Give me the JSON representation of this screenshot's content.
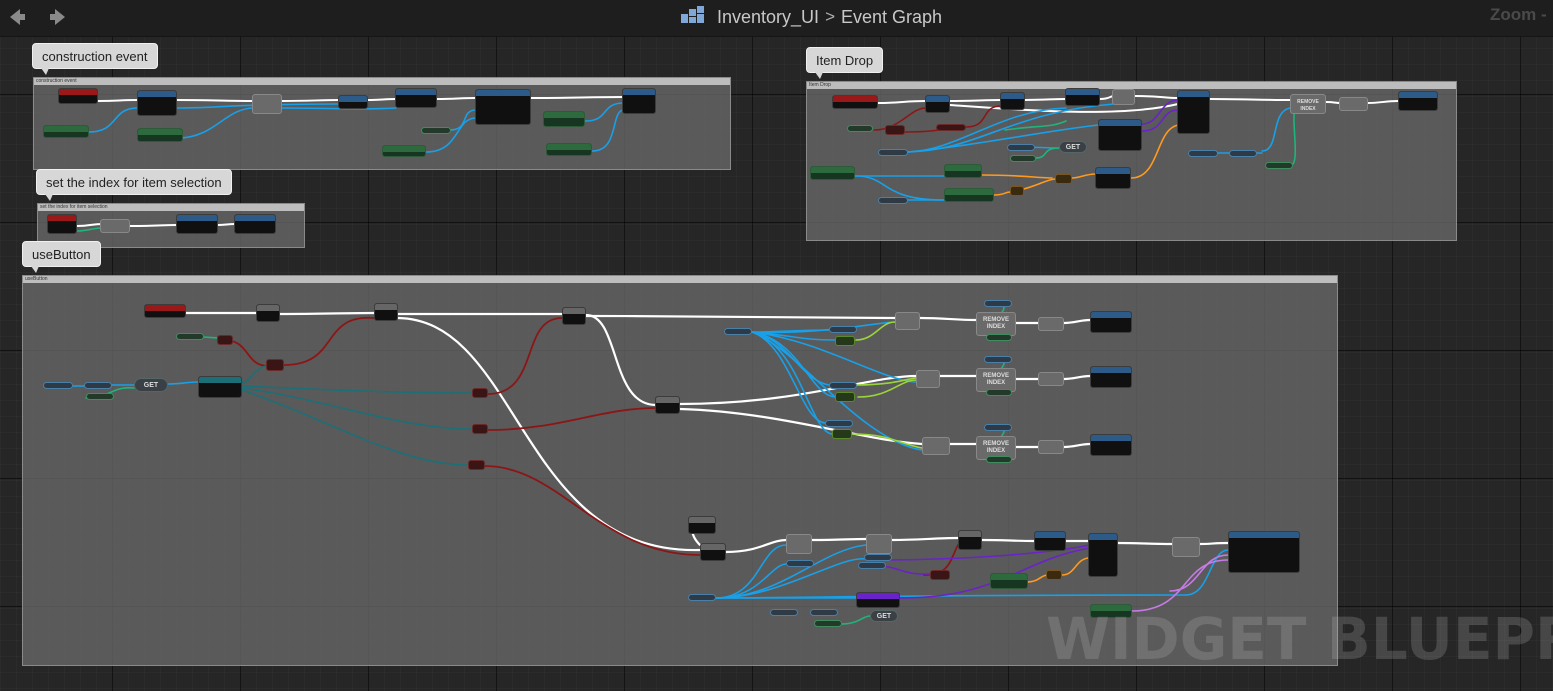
{
  "toolbar": {
    "back_icon": "back-arrow-icon",
    "forward_icon": "forward-arrow-icon"
  },
  "breadcrumb": {
    "icon": "graph-asset-icon",
    "asset": "Inventory_UI",
    "separator": ">",
    "graph": "Event Graph"
  },
  "zoom": {
    "label": "Zoom -"
  },
  "comments": [
    {
      "id": "construction",
      "bubble": "construction event",
      "strip": "construction event"
    },
    {
      "id": "index",
      "bubble": "set the index for item selection",
      "strip": "set the index for item selection"
    },
    {
      "id": "drop",
      "bubble": "Item Drop",
      "strip": "Item Drop"
    },
    {
      "id": "use",
      "bubble": "useButton",
      "strip": "useButton"
    }
  ],
  "node_text": {
    "get": "GET",
    "remove_index": "REMOVE INDEX"
  },
  "wire_colors": {
    "exec": "#ffffff",
    "object": "#18a0e8",
    "integer": "#1fb47c",
    "boolean": "#8c1616",
    "float": "#9ad63a",
    "struct": "#1d6f77",
    "string": "#ff9a1f",
    "class": "#6a23c8",
    "text": "#c67be5"
  },
  "watermark": "WIDGET BLUEPRINT"
}
